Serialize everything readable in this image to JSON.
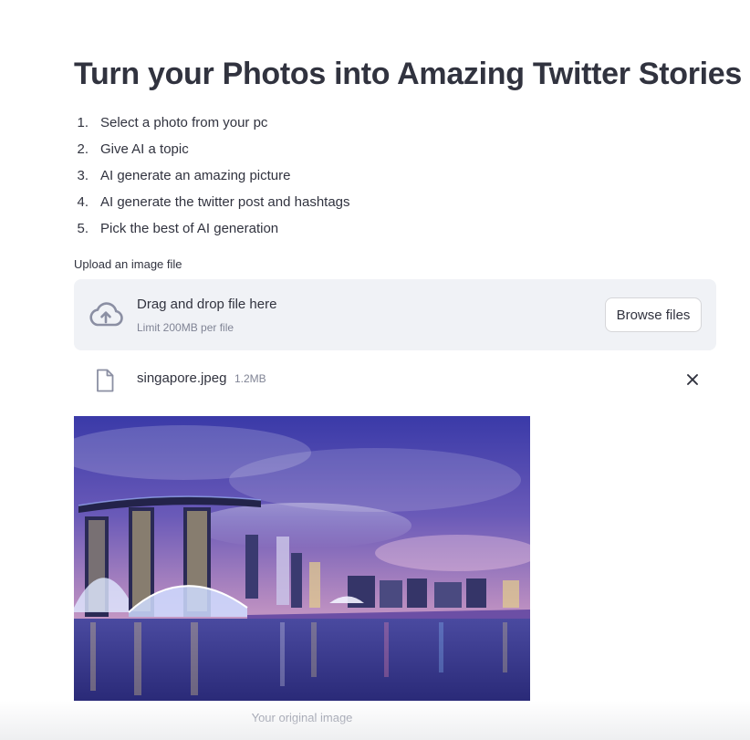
{
  "page": {
    "title": "Turn your Photos into Amazing Twitter Stories",
    "steps": [
      {
        "num": "1.",
        "text": "Select a photo from your pc"
      },
      {
        "num": "2.",
        "text": "Give AI a topic"
      },
      {
        "num": "3.",
        "text": "AI generate an amazing picture"
      },
      {
        "num": "4.",
        "text": "AI generate the twitter post and hashtags"
      },
      {
        "num": "5.",
        "text": "Pick the best of AI generation"
      }
    ]
  },
  "uploader": {
    "label": "Upload an image file",
    "drop_title": "Drag and drop file here",
    "limit": "Limit 200MB per file",
    "browse_label": "Browse files",
    "upload_icon": "cloud-upload-icon"
  },
  "file": {
    "name": "singapore.jpeg",
    "size": "1.2MB",
    "file_icon": "file-icon",
    "remove_icon": "close-icon"
  },
  "image": {
    "caption": "Your original image"
  },
  "colors": {
    "text": "#31333f",
    "muted": "#808495",
    "dropzone_bg": "#f0f2f6",
    "border": "#d6d6d9"
  }
}
